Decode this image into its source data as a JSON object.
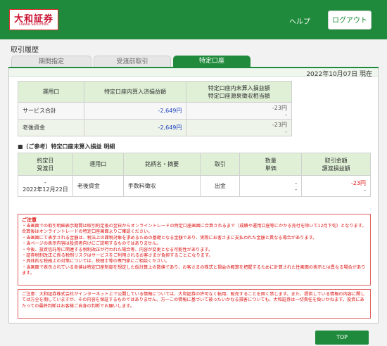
{
  "header": {
    "logo_text": "大和証券",
    "logo_sub": "Daiwa Securities",
    "help_label": "ヘルプ",
    "logout_label": "ログアウト"
  },
  "page_title": "取引履歴",
  "tabs": [
    {
      "label": "期間指定"
    },
    {
      "label": "受渡前取引"
    },
    {
      "label": "特定口座"
    }
  ],
  "date": "2022年10月07日 現在",
  "summary": {
    "headers": [
      "運用口",
      "特定口座内算入済損益額",
      "特定口座内未算入損益額",
      "特定口座源泉徴収相当額"
    ],
    "rows": [
      {
        "label": "サービス合計",
        "value1": "-2,649円",
        "value2": "-23円",
        "value3": "-"
      },
      {
        "label": "老後資金",
        "value1": "-2,649円",
        "value2": "-23円",
        "value3": "-"
      }
    ]
  },
  "section_title": "■（ご参考）特定口座未算入損益 明細",
  "detail": {
    "headers": {
      "contract_date": "約定日",
      "delivery_date": "受渡日",
      "account": "運用口",
      "name": "銘柄名・摘要",
      "trade": "取引",
      "quantity": "数量",
      "unit_price": "単価",
      "amount": "取引金額",
      "transfer_pl": "譲渡損益額"
    },
    "rows": [
      {
        "contract_date": "-",
        "delivery_date": "2022年12月22日",
        "account": "老後資金",
        "name": "手数料徴収",
        "trade": "出金",
        "quantity": "-",
        "unit_price": "-",
        "amount": "-23円",
        "transfer_pl": "-"
      }
    ]
  },
  "notice": {
    "title": "ご注意",
    "items": [
      "当画面での取引明細表示期間は取引約定後の翌日からオンライントレードの特定口座画面に合算されるまで（成績や運用口座等にかかる売付を除いて12月下旬）となります。合算後はオンライントレードの特定口座画面よりご確認ください。",
      "当画面にて表示される金額は、税法上の課税対象を求めるための基礎となる金額であり、実際にお客さまに支払われた金額と異なる場合があります。",
      "当ページの表示内容は投資者向けにご説明するものではありません。",
      "今後、投資信託等に関連する税制改正が行われた場合等、内容が変更となる可能性があります。",
      "証券税制改正に係る税制リスクはサービスをご利用されるお客さまが負担することになります。",
      "具体的な税務上の対策については、税理士等の専門家にご相談ください。",
      "当画面で表示されている各値は特定口座制度を想定した仮計算上の数値であり、お客さまの株式と損益の概算を把握するために計算された性画面の表示とは異なる場合があります。"
    ]
  },
  "disclaimer": "ご注意：大和証券株式会社がインターネット上で公開している情報については、大和証券の許可なく転用、販売することを固く禁じます。また、提供している情報の内容に関しては万全を期していますが、その内容を保証するものではありません。万一この情報に基づいて被ったいかなる損害についても、大和証券は一切責任を負いかねます。投資にあたっての最終判断はお客様ご自身の判断でお願いします。",
  "top_button": "TOP",
  "colors": {
    "brand_green": "#1f8a3b",
    "header_fill": "#dff0d6",
    "negative_blue": "#1a3fbf",
    "negative_red": "#dd1111"
  }
}
